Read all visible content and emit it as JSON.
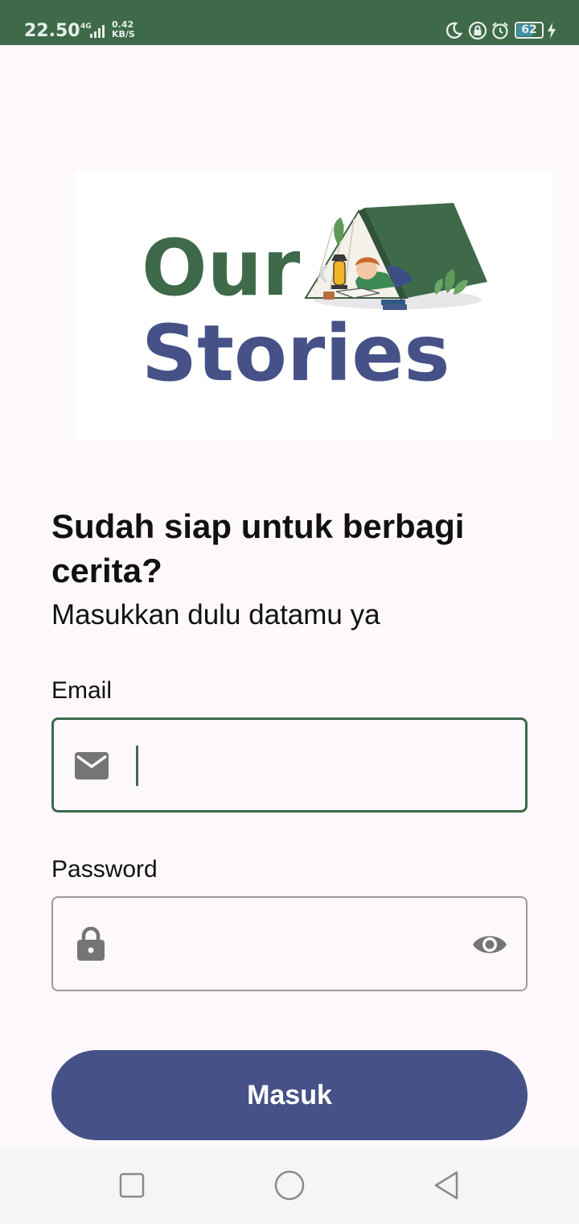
{
  "status_bar": {
    "time": "22.50",
    "network": "4G",
    "speed_value": "0.42",
    "speed_unit": "KB/S",
    "battery": "62",
    "battery_level": 0.62,
    "icons": [
      "moon-icon",
      "rotation-lock-icon",
      "alarm-icon",
      "battery-icon",
      "charging-icon"
    ],
    "background_color": "#3e6a4a"
  },
  "logo": {
    "line1": "Our",
    "line2": "Stories",
    "line1_color": "#3e6a4a",
    "line2_color": "#465287"
  },
  "headline": "Sudah siap untuk berbagi cerita?",
  "subheadline": "Masukkan dulu datamu ya",
  "email": {
    "label": "Email",
    "value": "",
    "icon": "mail-icon",
    "focused": true
  },
  "password": {
    "label": "Password",
    "value": "",
    "icon": "lock-icon",
    "toggle_icon": "eye-icon"
  },
  "login_button": {
    "label": "Masuk",
    "color": "#465287"
  },
  "nav_bar": {
    "buttons": [
      "recent-apps-icon",
      "home-icon",
      "back-icon"
    ]
  }
}
